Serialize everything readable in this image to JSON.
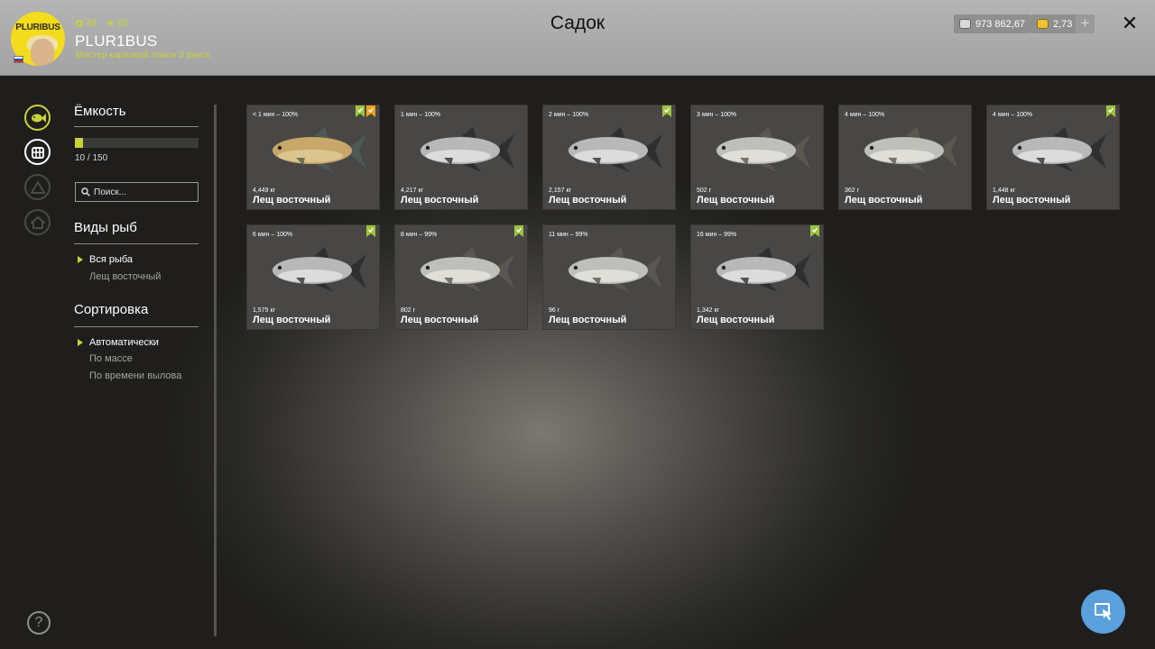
{
  "header": {
    "avatar_logo": "PLURIBUS",
    "stat_level": "48",
    "stat_stars": "65",
    "username": "PLUR1BUS",
    "rank": "Мастер карповой ловли 3 ранга",
    "title": "Садок",
    "silver": "973 862,67",
    "gold": "2,73",
    "plus_label": "+",
    "close_label": "✕"
  },
  "sidebar": {
    "capacity_title": "Ёмкость",
    "capacity_text": "10 / 150",
    "capacity_fraction": 0.0667,
    "search_placeholder": "Поиск...",
    "species_title": "Виды рыб",
    "species_options": [
      "Вся рыба",
      "Лещ восточный"
    ],
    "species_selected": 0,
    "sort_title": "Сортировка",
    "sort_options": [
      "Автоматически",
      "По массе",
      "По времени вылова"
    ],
    "sort_selected": 0,
    "help_label": "?"
  },
  "fish": [
    {
      "time": "< 1 мин – 100%",
      "weight": "4,449 кг",
      "name": "Лещ восточный",
      "color": "golden",
      "green_mark": true,
      "orange_mark": true
    },
    {
      "time": "1 мин – 100%",
      "weight": "4,217 кг",
      "name": "Лещ восточный",
      "color": "silver",
      "green_mark": false,
      "orange_mark": false
    },
    {
      "time": "2 мин – 100%",
      "weight": "2,157 кг",
      "name": "Лещ восточный",
      "color": "silver",
      "green_mark": true,
      "orange_mark": false
    },
    {
      "time": "3 мин – 100%",
      "weight": "502 г",
      "name": "Лещ восточный",
      "color": "pale",
      "green_mark": false,
      "orange_mark": false
    },
    {
      "time": "4 мин – 100%",
      "weight": "362 г",
      "name": "Лещ восточный",
      "color": "pale",
      "green_mark": false,
      "orange_mark": false
    },
    {
      "time": "4 мин – 100%",
      "weight": "1,448 кг",
      "name": "Лещ восточный",
      "color": "silver",
      "green_mark": true,
      "orange_mark": false
    },
    {
      "time": "6 мин – 100%",
      "weight": "1,575 кг",
      "name": "Лещ восточный",
      "color": "silver",
      "green_mark": true,
      "orange_mark": false
    },
    {
      "time": "8 мин – 99%",
      "weight": "802 г",
      "name": "Лещ восточный",
      "color": "pale",
      "green_mark": true,
      "orange_mark": false
    },
    {
      "time": "11 мин – 99%",
      "weight": "96 г",
      "name": "Лещ восточный",
      "color": "pale",
      "green_mark": false,
      "orange_mark": false
    },
    {
      "time": "16 мин – 99%",
      "weight": "1,342 кг",
      "name": "Лещ восточный",
      "color": "silver",
      "green_mark": true,
      "orange_mark": false
    }
  ],
  "colors": {
    "accent": "#c8d33b",
    "card_bg": "#484745",
    "mark_green": "#9dc33b",
    "mark_orange": "#f0a21a",
    "fab": "#5aa0dc"
  }
}
